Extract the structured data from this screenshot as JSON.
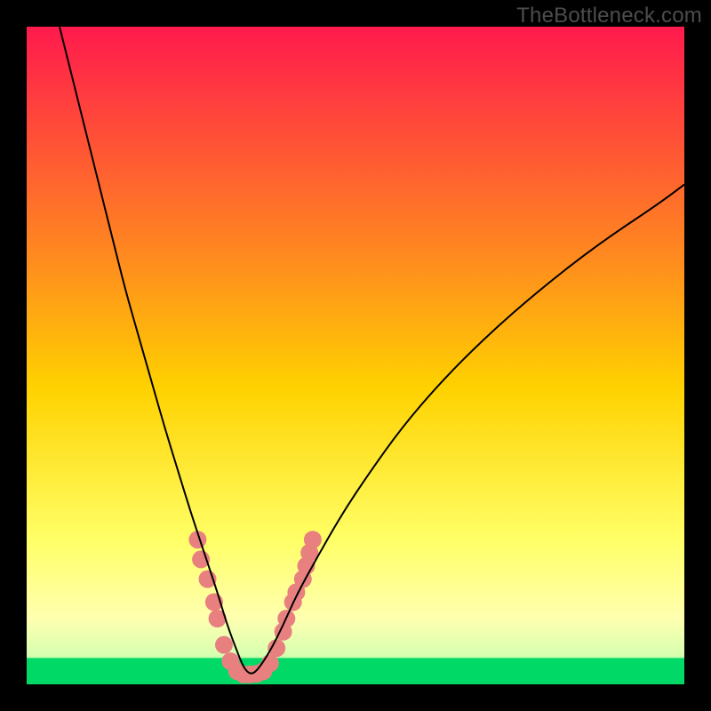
{
  "watermark": "TheBottleneck.com",
  "chart_data": {
    "type": "line",
    "title": "",
    "xlabel": "",
    "ylabel": "",
    "xlim": [
      0,
      100
    ],
    "ylim": [
      0,
      100
    ],
    "grid": false,
    "legend": false,
    "background_gradient": {
      "top_color": "#ff1a4d",
      "mid_color": "#ffd200",
      "bottom_color": "#00d966",
      "stops": [
        {
          "offset": 0.0,
          "color": "#ff1a4d"
        },
        {
          "offset": 0.35,
          "color": "#ff8a1f"
        },
        {
          "offset": 0.55,
          "color": "#ffd200"
        },
        {
          "offset": 0.78,
          "color": "#ffff66"
        },
        {
          "offset": 0.9,
          "color": "#ffffb0"
        },
        {
          "offset": 0.955,
          "color": "#d8ffb0"
        },
        {
          "offset": 1.0,
          "color": "#00d966"
        }
      ]
    },
    "series": [
      {
        "name": "bottleneck-curve",
        "color": "#000000",
        "stroke_width": 2,
        "x": [
          5,
          7,
          9,
          11,
          13,
          15,
          17,
          19,
          21,
          23,
          25,
          27,
          29,
          30.5,
          32,
          33,
          34,
          35,
          37,
          39,
          41,
          44,
          48,
          52,
          57,
          63,
          70,
          78,
          87,
          96,
          100
        ],
        "values": [
          100,
          92,
          84,
          76,
          68,
          60,
          53,
          46,
          39,
          32.5,
          26,
          20,
          14,
          9,
          5,
          2.5,
          1.5,
          2,
          5,
          9,
          13.5,
          19,
          26,
          32,
          39,
          46,
          53,
          60,
          67,
          73,
          76
        ]
      }
    ],
    "markers": {
      "name": "highlight-dots",
      "color": "#e98080",
      "radius": 10,
      "x": [
        26,
        26.5,
        27.5,
        28.5,
        29,
        30,
        31,
        32,
        33,
        34,
        35,
        36,
        37,
        38,
        39,
        39.5,
        40.5,
        41,
        42,
        42.5,
        43,
        43.5
      ],
      "values": [
        22,
        19,
        16,
        12.5,
        10,
        6,
        3.5,
        2,
        1.5,
        1.5,
        1.6,
        2,
        3.2,
        5.5,
        8,
        10,
        12.5,
        14,
        16,
        18,
        20,
        22
      ]
    },
    "bottom_band": {
      "y_from": 0,
      "y_to": 4,
      "color": "#00d966"
    }
  }
}
